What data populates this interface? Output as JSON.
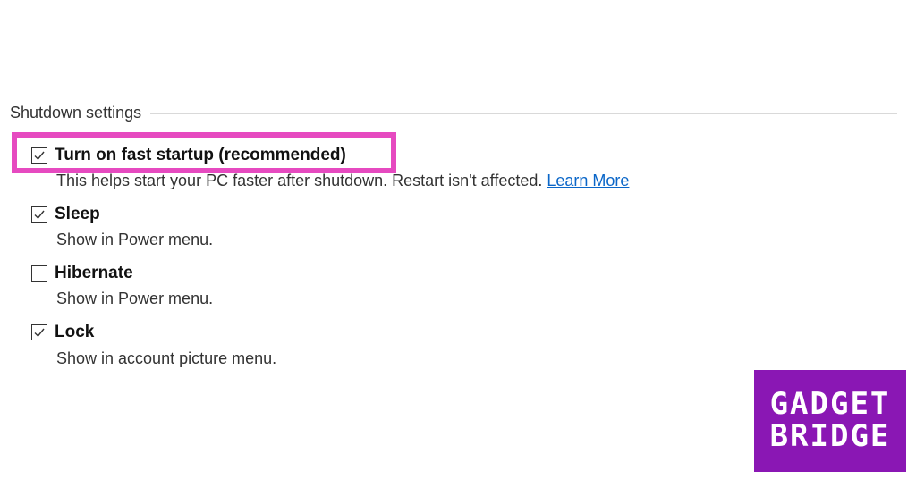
{
  "section": {
    "title": "Shutdown settings"
  },
  "options": [
    {
      "label": "Turn on fast startup (recommended)",
      "checked": true,
      "description": "This helps start your PC faster after shutdown. Restart isn't affected.",
      "link": "Learn More"
    },
    {
      "label": "Sleep",
      "checked": true,
      "description": "Show in Power menu."
    },
    {
      "label": "Hibernate",
      "checked": false,
      "description": "Show in Power menu."
    },
    {
      "label": "Lock",
      "checked": true,
      "description": "Show in account picture menu."
    }
  ],
  "highlight": {
    "color": "#e64ac0"
  },
  "watermark": {
    "line1": "GADGET",
    "line2": "BRIDGE",
    "background": "#8a17b4"
  }
}
